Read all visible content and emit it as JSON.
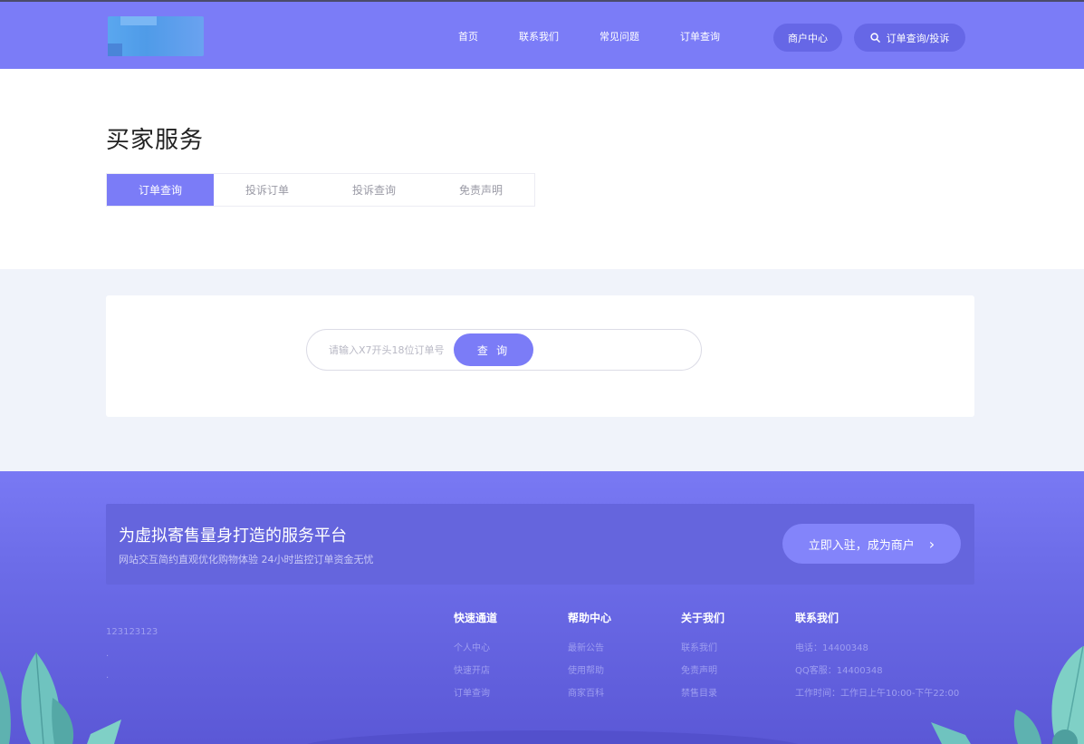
{
  "header": {
    "nav": [
      {
        "label": "首页"
      },
      {
        "label": "联系我们"
      },
      {
        "label": "常见问题"
      },
      {
        "label": "订单查询"
      }
    ],
    "merchant_label": "商户中心",
    "search_label": "订单查询/投诉"
  },
  "page": {
    "title": "买家服务",
    "tabs": [
      {
        "label": "订单查询",
        "active": true
      },
      {
        "label": "投诉订单",
        "active": false
      },
      {
        "label": "投诉查询",
        "active": false
      },
      {
        "label": "免责声明",
        "active": false
      }
    ]
  },
  "query": {
    "placeholder": "请输入X7开头18位订单号",
    "button_label": "查 询"
  },
  "footer": {
    "banner_title": "为虚拟寄售量身打造的服务平台",
    "banner_subtitle": "网站交互简约直观优化购物体验 24小时监控订单资金无忧",
    "join_label": "立即入驻，成为商户",
    "join_icon": "chevron-right-icon",
    "left_text": [
      "123123123",
      ".",
      "."
    ],
    "columns": [
      {
        "title": "快速通道",
        "links": [
          "个人中心",
          "快速开店",
          "订单查询"
        ]
      },
      {
        "title": "帮助中心",
        "links": [
          "最新公告",
          "使用帮助",
          "商家百科"
        ]
      },
      {
        "title": "关于我们",
        "links": [
          "联系我们",
          "免责声明",
          "禁售目录"
        ]
      },
      {
        "title": "联系我们",
        "links": [
          "电话：14400348",
          "QQ客服：14400348",
          "工作时间：工作日上午10:00-下午22:00"
        ]
      }
    ]
  },
  "colors": {
    "accent": "#7b7cf7",
    "header_bg": "#7b7cf7",
    "query_bg": "#f0f3fa",
    "footer_bg": "#6c6ce8"
  }
}
